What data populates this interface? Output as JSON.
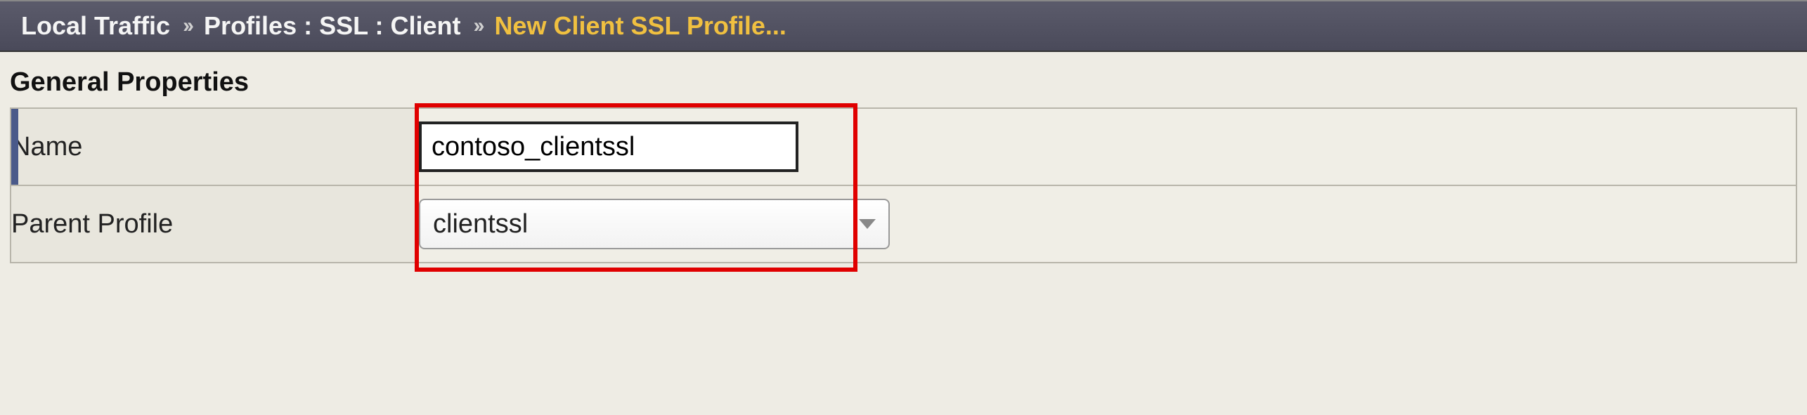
{
  "breadcrumb": {
    "root": "Local Traffic",
    "path": "Profiles : SSL : Client",
    "current": "New Client SSL Profile...",
    "sep": "››"
  },
  "section": {
    "title": "General Properties"
  },
  "form": {
    "name_label": "Name",
    "name_value": "contoso_clientssl",
    "parent_label": "Parent Profile",
    "parent_value": "clientssl"
  }
}
